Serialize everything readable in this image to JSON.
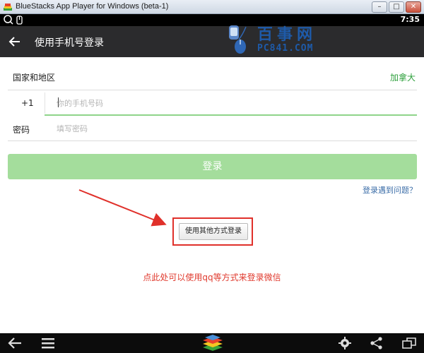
{
  "window": {
    "title": "BlueStacks App Player for Windows (beta-1)",
    "minimize_glyph": "–",
    "maximize_glyph": "□",
    "close_glyph": "✕"
  },
  "statusbar": {
    "time": "7:35"
  },
  "actionbar": {
    "title": "使用手机号登录",
    "back_icon": "back-arrow-icon"
  },
  "watermark": {
    "text_cn": "百事网",
    "text_en": "PC841.COM"
  },
  "form": {
    "country_label": "国家和地区",
    "country_value": "加拿大",
    "country_code": "+1",
    "phone_placeholder": "你的手机号码",
    "password_label": "密码",
    "password_placeholder": "填写密码",
    "login_button": "登录",
    "help_link": "登录遇到问题？",
    "other_login_button": "使用其他方式登录"
  },
  "annotation": {
    "hint": "点此处可以使用qq等方式来登录微信"
  },
  "colors": {
    "accent_green": "#2ea03c",
    "login_disabled": "#a4dd9c",
    "annotation_red": "#e03a2e",
    "actionbar_bg": "#2b2b2d"
  },
  "navbar": {
    "icons": [
      "back-icon",
      "menu-icon",
      "bluestacks-logo-icon",
      "settings-icon",
      "share-icon",
      "window-icon"
    ]
  }
}
